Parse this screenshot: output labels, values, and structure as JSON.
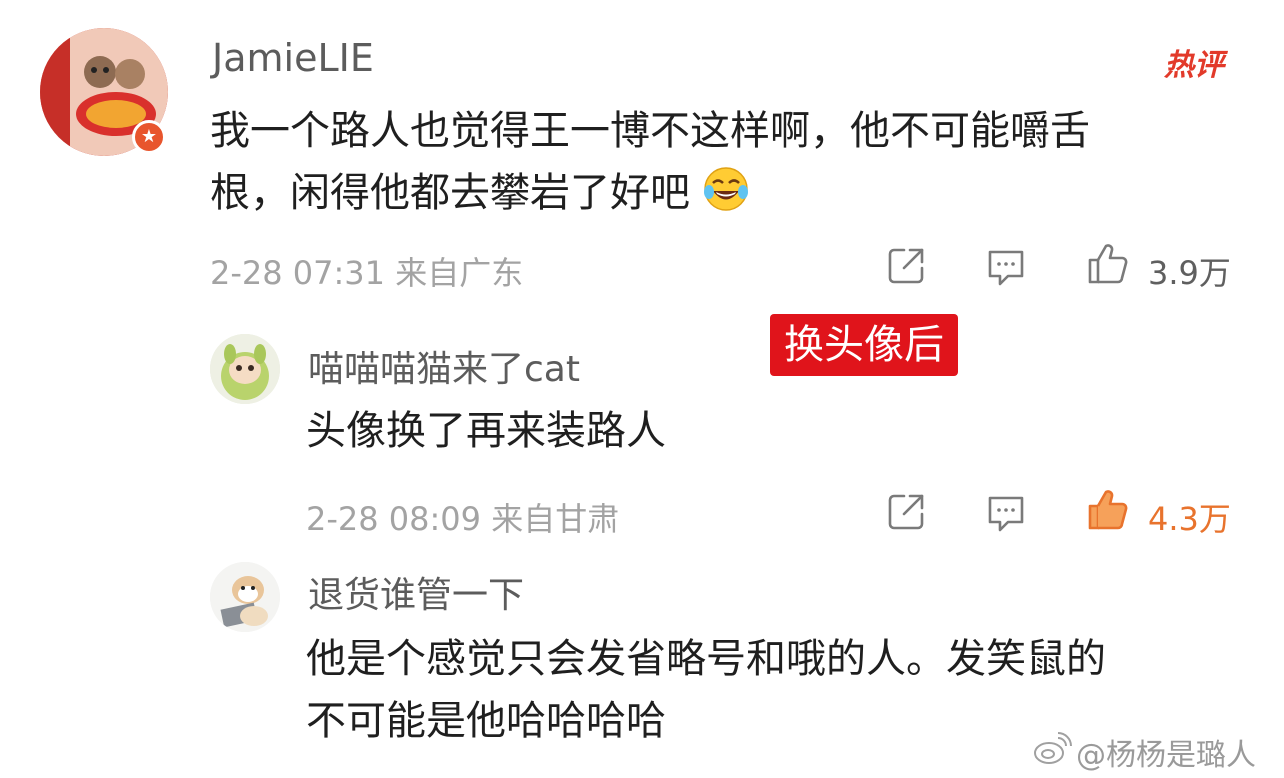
{
  "badge_hot": "热评",
  "overlay_tag": "换头像后",
  "watermark": "@杨杨是璐人",
  "comments": [
    {
      "username": "JamieLIE",
      "text_line1": "我一个路人也觉得王一博不这样啊，他不可能嚼舌",
      "text_line2": "根，闲得他都去攀岩了好吧",
      "emoji": "laughing-tears-emoji",
      "meta": "2-28 07:31 来自广东",
      "likes": "3.9万",
      "liked": false
    },
    {
      "username": "喵喵喵猫来了cat",
      "text_line1": "头像换了再来装路人",
      "meta": "2-28 08:09 来自甘肃",
      "likes": "4.3万",
      "liked": true
    },
    {
      "username": "退货谁管一下",
      "text_line1": "他是个感觉只会发省略号和哦的人。发笑鼠的",
      "text_line2": "不可能是他哈哈哈哈"
    }
  ],
  "colors": {
    "accent_red": "#e0141b",
    "liked_orange": "#e8732d",
    "meta_gray": "#a3a3a3"
  }
}
